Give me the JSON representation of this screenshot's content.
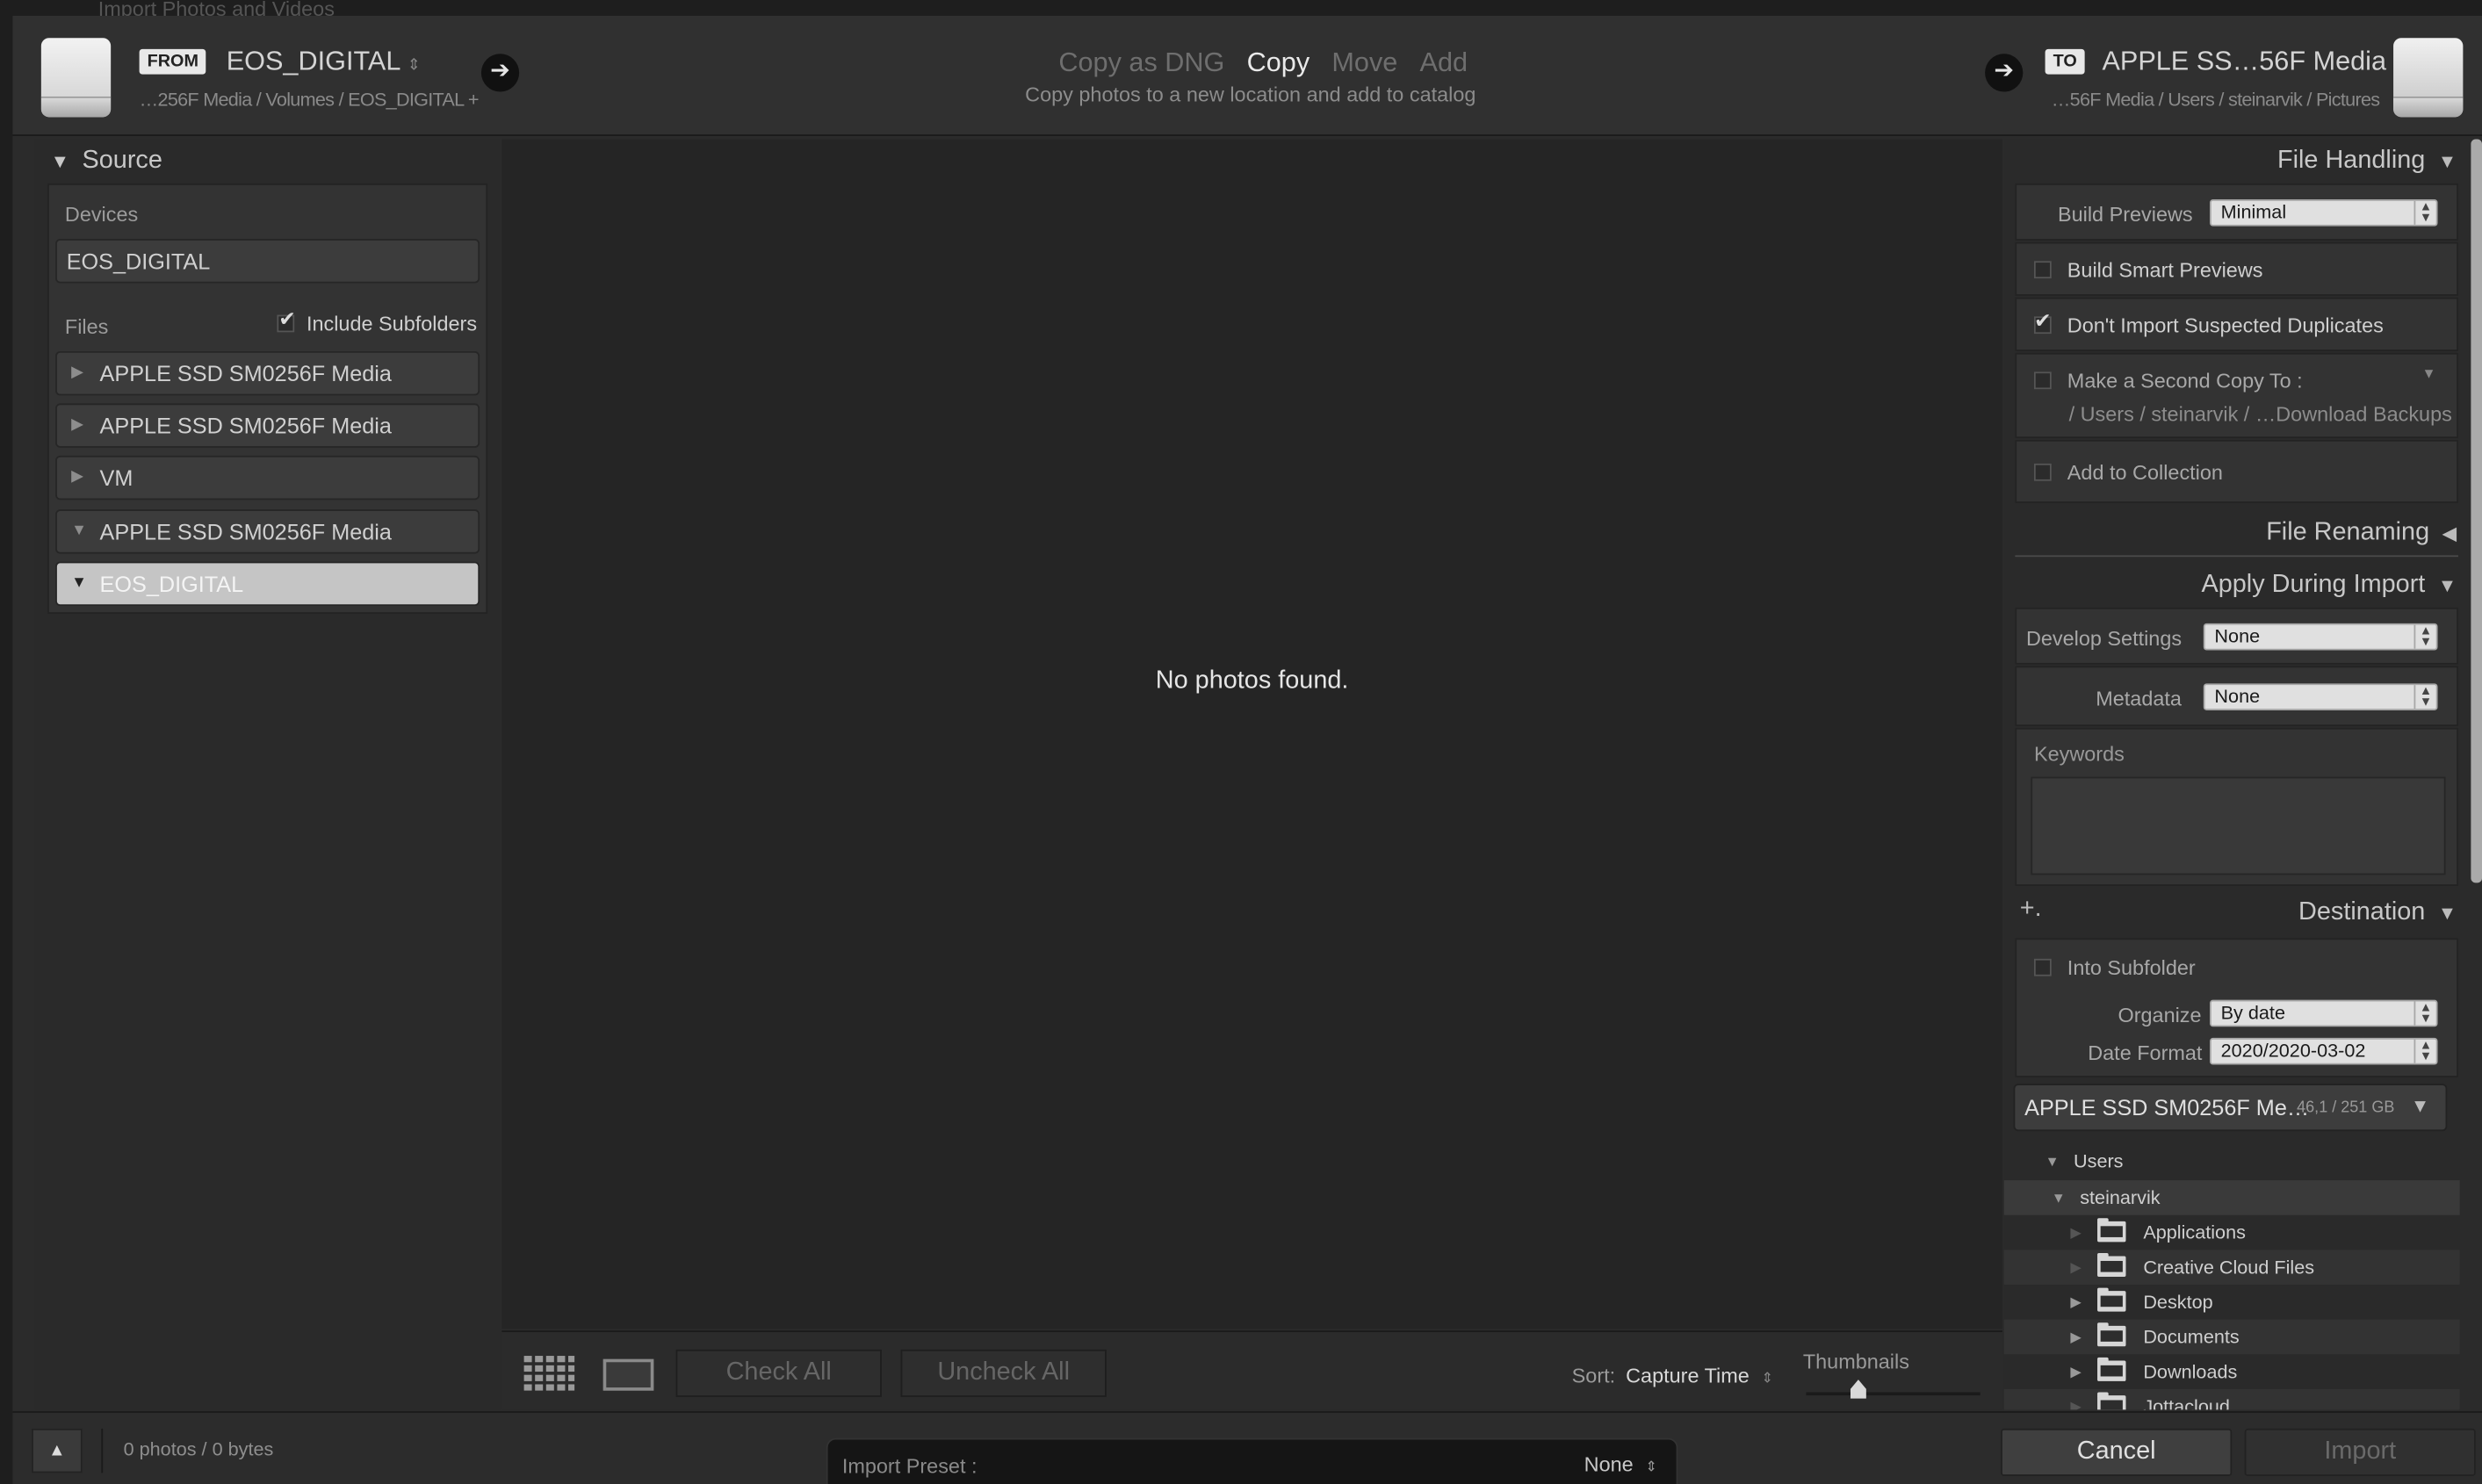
{
  "window": {
    "title": "Import Photos and Videos"
  },
  "header": {
    "from_tag": "FROM",
    "from_name": "EOS_DIGITAL",
    "from_path": "…256F Media / Volumes / EOS_DIGITAL +",
    "modes": [
      "Copy as DNG",
      "Copy",
      "Move",
      "Add"
    ],
    "active_mode": "Copy",
    "mode_desc": "Copy photos to a new location and add to catalog",
    "to_tag": "TO",
    "to_name": "APPLE SS…56F Media",
    "to_path": "…56F Media / Users / steinarvik / Pictures"
  },
  "source": {
    "title": "Source",
    "devices_label": "Devices",
    "device": "EOS_DIGITAL",
    "files_label": "Files",
    "include_subfolders": "Include Subfolders",
    "items": [
      {
        "label": "APPLE SSD SM0256F Media",
        "expanded": false
      },
      {
        "label": "APPLE SSD SM0256F Media",
        "expanded": false
      },
      {
        "label": "VM",
        "expanded": false
      },
      {
        "label": "APPLE SSD SM0256F Media",
        "expanded": true
      },
      {
        "label": "EOS_DIGITAL",
        "expanded": true,
        "selected": true
      }
    ]
  },
  "center": {
    "message": "No photos found.",
    "check_all": "Check All",
    "uncheck_all": "Uncheck All",
    "sort_label": "Sort:",
    "sort_value": "Capture Time",
    "thumbnails_label": "Thumbnails",
    "thumbnail_size": 0.3
  },
  "file_handling": {
    "title": "File Handling",
    "build_previews_label": "Build Previews",
    "build_previews_value": "Minimal",
    "smart_previews": "Build Smart Previews",
    "no_duplicates": "Don't Import Suspected Duplicates",
    "second_copy": "Make a Second Copy To :",
    "second_copy_path": "/ Users / steinarvik / …Download Backups",
    "add_collection": "Add to Collection"
  },
  "file_renaming": {
    "title": "File Renaming"
  },
  "apply_during_import": {
    "title": "Apply During Import",
    "develop_label": "Develop Settings",
    "develop_value": "None",
    "metadata_label": "Metadata",
    "metadata_value": "None",
    "keywords_label": "Keywords"
  },
  "destination": {
    "title": "Destination",
    "add_icon": "+.",
    "into_subfolder": "Into Subfolder",
    "organize_label": "Organize",
    "organize_value": "By date",
    "date_format_label": "Date Format",
    "date_format_value": "2020/2020-03-02",
    "volume_name": "APPLE SSD SM0256F Me…",
    "volume_space": "46,1 / 251 GB",
    "tree": [
      {
        "label": "Users",
        "level": 0,
        "expanded": true
      },
      {
        "label": "steinarvik",
        "level": 1,
        "expanded": true
      },
      {
        "label": "Applications",
        "level": 2,
        "folder": true
      },
      {
        "label": "Creative Cloud Files",
        "level": 2,
        "folder": true
      },
      {
        "label": "Desktop",
        "level": 2,
        "folder": true,
        "has_children": true
      },
      {
        "label": "Documents",
        "level": 2,
        "folder": true,
        "has_children": true
      },
      {
        "label": "Downloads",
        "level": 2,
        "folder": true,
        "has_children": true
      },
      {
        "label": "Jottacloud",
        "level": 2,
        "folder": true
      }
    ]
  },
  "footer": {
    "stats": "0 photos / 0 bytes",
    "preset_label": "Import Preset :",
    "preset_value": "None",
    "cancel": "Cancel",
    "import": "Import"
  }
}
